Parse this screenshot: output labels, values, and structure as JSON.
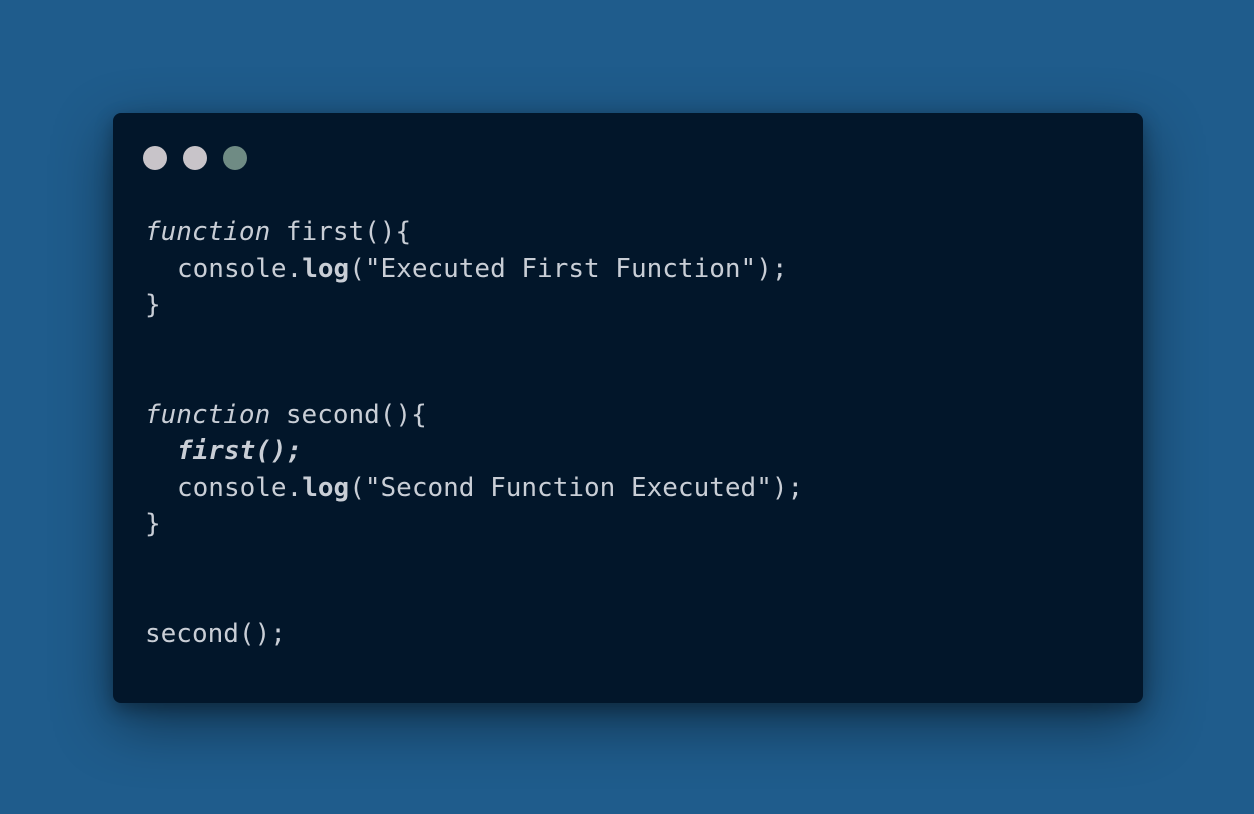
{
  "window": {
    "controls": [
      {
        "name": "close",
        "color": "#c8c4c9"
      },
      {
        "name": "minimize",
        "color": "#c8c4c9"
      },
      {
        "name": "maximize",
        "color": "#6f8b84"
      }
    ]
  },
  "code": {
    "func1": {
      "keyword": "function",
      "signature": " first(){",
      "obj": "console.",
      "method": "log",
      "args": "(\"Executed First Function\");",
      "close": "}"
    },
    "func2": {
      "keyword": "function",
      "signature": " second(){",
      "call": "first();",
      "obj": "console.",
      "method": "log",
      "args": "(\"Second Function Executed\");",
      "close": "}"
    },
    "invoke": "second();"
  }
}
